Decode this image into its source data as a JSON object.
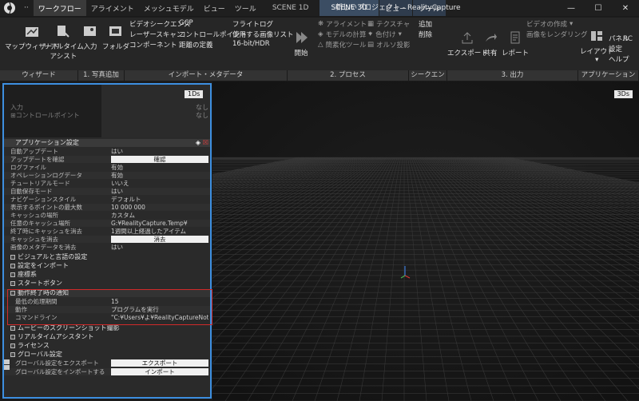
{
  "titlebar": {
    "tab_dots": "··",
    "menu_tabs": [
      "ワークフロー",
      "アライメント",
      "メッシュモデル",
      "ビュー",
      "ツール"
    ],
    "scene_1d": "SCENE 1D",
    "scene_3d": "SCENE 3D",
    "sub_tabs": [
      "ビュー",
      "ツール"
    ],
    "window_title": "新しいプロジェクト - RealityCapture",
    "rc_badge": "RC",
    "help_badge": "?"
  },
  "ribbon": {
    "workflow": {
      "wizard": "マップウィザード",
      "realtime": "リアルタイム",
      "assist": "アシスト",
      "inputs": "入力",
      "folder": "フォルダ"
    },
    "import": {
      "video_seq": "ビデオシークエンス",
      "gcp": "GCP",
      "laser_scan": "レーザースキャン",
      "control_point": "コントロールポイント",
      "component": "コンポーネント",
      "distance_def": "距離の定義",
      "flight_log": "フライトログ",
      "used_images": "使用する画像リスト",
      "hdr": "16-bit/HDR"
    },
    "process": {
      "start": "開始",
      "align": "アライメント",
      "compute_model": "モデルの計算",
      "simplify": "簡素化ツール",
      "texture": "テクスチャ",
      "colorize": "色付け",
      "ortho": "オルソ投影"
    },
    "sequence": {
      "add": "追加",
      "delete": "削除"
    },
    "output": {
      "export": "エクスポート",
      "share": "共有",
      "report": "レポート",
      "make_video": "ビデオの作成",
      "render_image": "画像をレンダリング"
    },
    "app": {
      "layout": "レイアウト",
      "panel": "パネル",
      "settings": "設定",
      "help": "ヘルプ"
    },
    "group_labels": [
      "ウィザード",
      "1. 写真追加",
      "インポート・メタデータ",
      "2. プロセス",
      "シークエンス",
      "3. 出力",
      "アプリケーション"
    ]
  },
  "left_panel": {
    "badge": "1Ds",
    "tree": [
      {
        "label": "入力",
        "value": "なし"
      },
      {
        "label": "コントロールポイント",
        "value": "なし"
      }
    ],
    "section_title": "アプリケーション設定",
    "properties": [
      {
        "key": "自動アップデート",
        "value": "はい"
      },
      {
        "key": "アップデートを確認",
        "button": "確認"
      },
      {
        "key": "ログファイル",
        "value": "有効"
      },
      {
        "key": "オペレーションログデータ",
        "value": "有効"
      },
      {
        "key": "チュートリアルモード",
        "value": "いいえ"
      },
      {
        "key": "自動保存モード",
        "value": "はい"
      },
      {
        "key": "ナビゲーションスタイル",
        "value": "デフォルト"
      },
      {
        "key": "表示するポイントの最大数",
        "value": "10 000 000"
      },
      {
        "key": "キャッシュの場所",
        "value": "カスタム"
      },
      {
        "key": "任意のキャッシュ場所",
        "value": "G:¥RealityCapture.Temp¥"
      },
      {
        "key": "終了時にキャッシュを消去",
        "value": "1週間以上経過したアイテム"
      },
      {
        "key": "キャッシュを消去",
        "button": "消去"
      },
      {
        "key": "画像のメタデータを消去",
        "value": "はい"
      }
    ],
    "groups": [
      "ビジュアルと言語の設定",
      "設定をインポート",
      "座標系",
      "スタートボタン"
    ],
    "notify_group": "動作終了時の通知",
    "notify_props": [
      {
        "key": "最低の処理期間",
        "value": "15"
      },
      {
        "key": "動作",
        "value": "プログラムを実行"
      },
      {
        "key": "コマンドライン",
        "value": "\"C:¥Users¥よ¥RealityCaptureNotif..."
      }
    ],
    "more_groups": [
      "ムービーのスクリーンショット撮影",
      "リアルタイムアシスタント",
      "ライセンス"
    ],
    "global_group": "グローバル設定",
    "global_props": [
      {
        "key": "グローバル設定をエクスポート",
        "button": "エクスポート"
      },
      {
        "key": "グローバル設定をインポートする",
        "button": "インポート"
      }
    ]
  },
  "viewport": {
    "badge": "3Ds"
  }
}
